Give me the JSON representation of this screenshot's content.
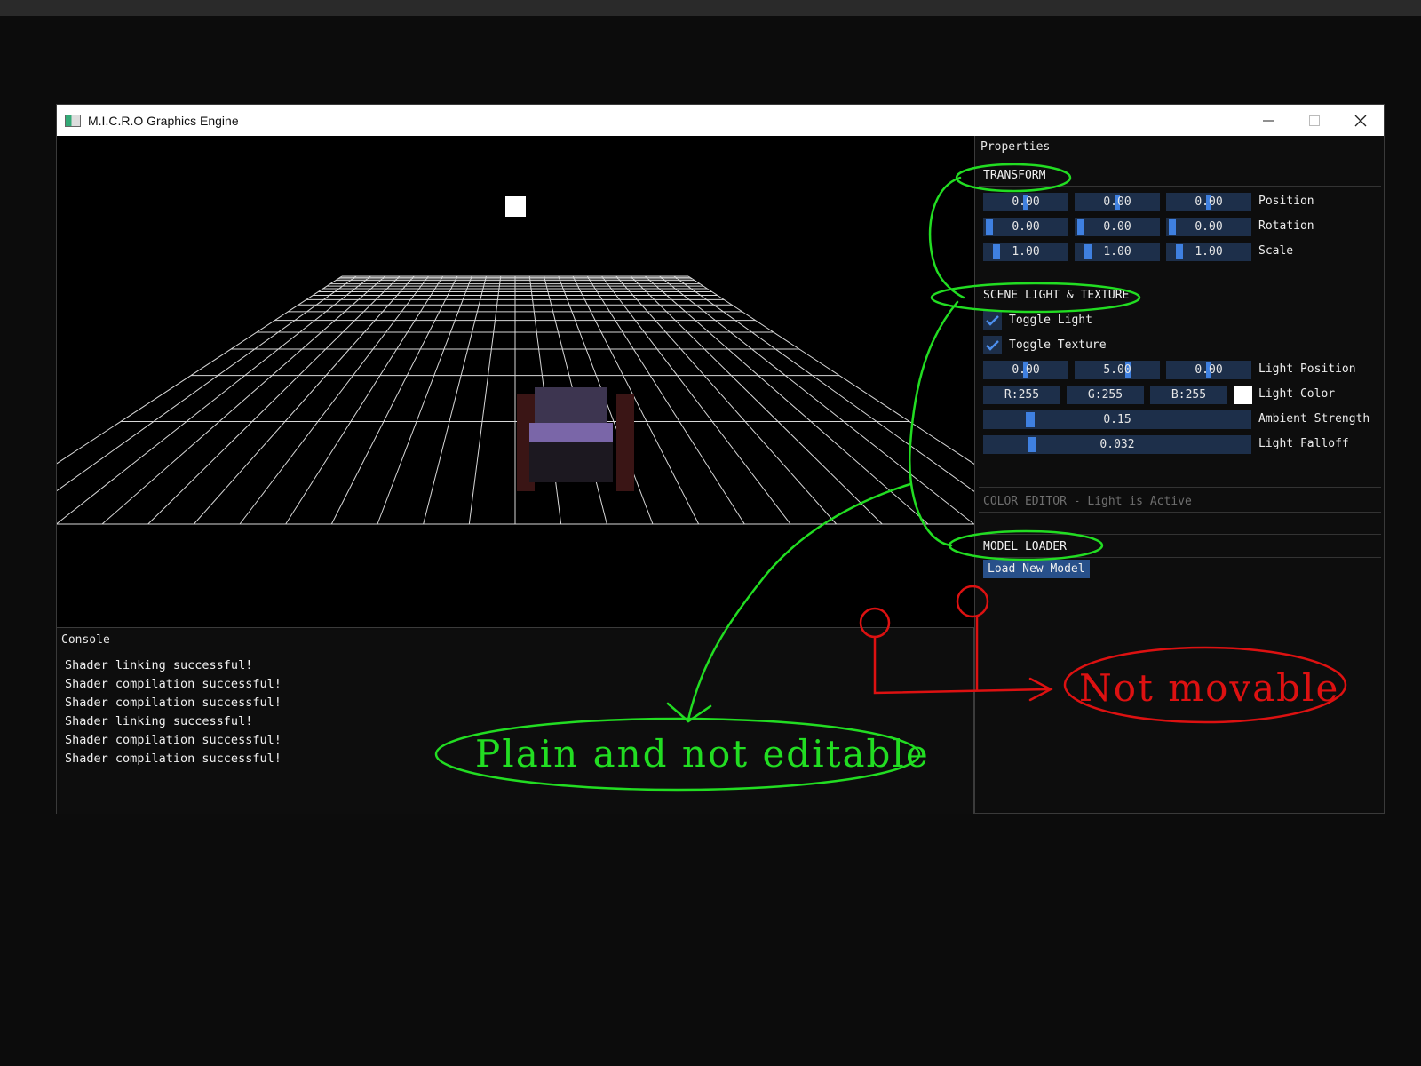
{
  "window": {
    "title": "M.I.C.R.O Graphics Engine"
  },
  "console": {
    "title": "Console",
    "lines": [
      "Shader linking successful!",
      "Shader compilation successful!",
      "Shader compilation successful!",
      "Shader linking successful!",
      "Shader compilation successful!",
      "Shader compilation successful!"
    ]
  },
  "properties": {
    "title": "Properties",
    "transform": {
      "header": "TRANSFORM",
      "position": {
        "label": "Position",
        "values": [
          "0.00",
          "0.00",
          "0.00"
        ]
      },
      "rotation": {
        "label": "Rotation",
        "values": [
          "0.00",
          "0.00",
          "0.00"
        ]
      },
      "scale": {
        "label": "Scale",
        "values": [
          "1.00",
          "1.00",
          "1.00"
        ]
      }
    },
    "scene": {
      "header": "SCENE LIGHT & TEXTURE",
      "toggle_light": {
        "label": "Toggle Light",
        "checked": true
      },
      "toggle_texture": {
        "label": "Toggle Texture",
        "checked": true
      },
      "light_position": {
        "label": "Light Position",
        "values": [
          "0.00",
          "5.00",
          "0.00"
        ]
      },
      "light_color": {
        "label": "Light Color",
        "r": "R:255",
        "g": "G:255",
        "b": "B:255",
        "swatch": "#ffffff"
      },
      "ambient": {
        "label": "Ambient Strength",
        "value": "0.15"
      },
      "falloff": {
        "label": "Light Falloff",
        "value": "0.032"
      }
    },
    "color_editor": {
      "label": "COLOR EDITOR - Light is Active"
    },
    "model_loader": {
      "header": "MODEL LOADER",
      "button": "Load New Model"
    }
  },
  "annotations": {
    "green_text": "Plain and not editable",
    "red_text": "Not movable",
    "green_color": "#22dd22",
    "red_color": "#dd1111"
  },
  "colors": {
    "field_bg": "#1d2f4a",
    "grab": "#3f80e0",
    "button": "#28508a"
  }
}
